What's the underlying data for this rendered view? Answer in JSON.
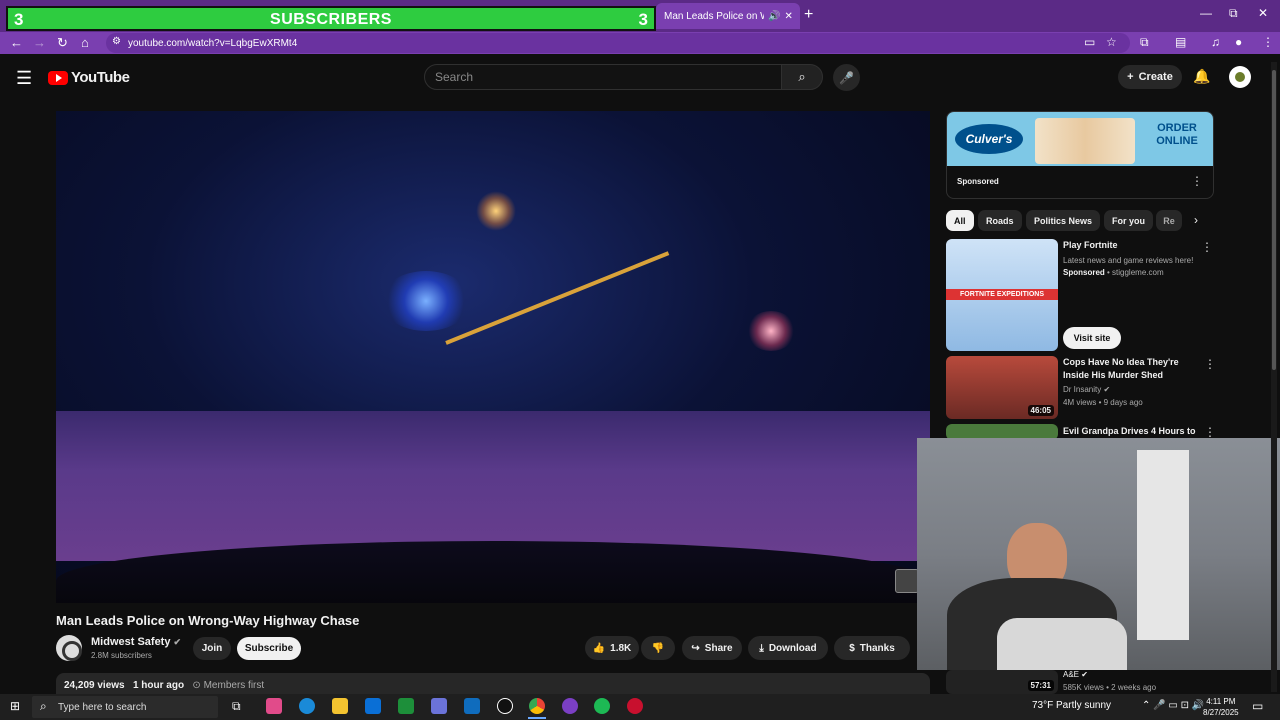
{
  "overlay": {
    "left_count": "3",
    "label": "SUBSCRIBERS",
    "right_count": "3"
  },
  "browser": {
    "tab_title": "Man Leads Police on Wrong",
    "url": "youtube.com/watch?v=LqbgEwXRMt4",
    "new_tab": "+",
    "win_min": "—",
    "win_max": "⧉",
    "win_close": "✕"
  },
  "yt": {
    "logo": "YouTube",
    "search_placeholder": "Search",
    "create": "Create"
  },
  "video": {
    "title": "Man Leads Police on Wrong-Way Highway Chase",
    "channel": "Midwest Safety",
    "subscribers": "2.8M subscribers",
    "join": "Join",
    "subscribe": "Subscribe",
    "likes": "1.8K",
    "share": "Share",
    "download": "Download",
    "thanks": "Thanks",
    "views": "24,209 views",
    "age": "1 hour ago",
    "members": "Members first"
  },
  "ad": {
    "brand": "Culver's",
    "cta": "ORDER ONLINE",
    "sponsored": "Sponsored"
  },
  "chips": [
    "All",
    "Roads",
    "Politics News",
    "For you",
    "Re"
  ],
  "related": [
    {
      "title": "Play Fortnite",
      "line1": "Latest news and game reviews here!",
      "sponsored": "Sponsored",
      "domain": "stiggleme.com",
      "button": "Visit site",
      "thumb_text": "FORTNITE EXPEDITIONS"
    },
    {
      "title": "Cops Have No Idea They're Inside His Murder Shed",
      "channel": "Dr Insanity",
      "meta": "4M views • 9 days ago",
      "duration": "46:05"
    },
    {
      "title": "Evil Grandpa Drives 4 Hours to"
    },
    {
      "channel": "A&E",
      "meta": "585K views • 2 weeks ago",
      "duration": "57:31"
    }
  ],
  "taskbar": {
    "search_placeholder": "Type here to search",
    "weather": "73°F  Partly sunny",
    "time": "4:11 PM",
    "date": "8/27/2025"
  }
}
